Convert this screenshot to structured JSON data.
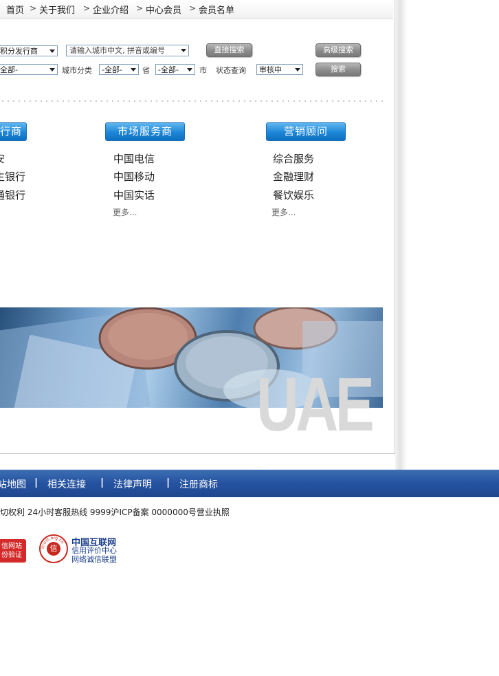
{
  "breadcrumb": {
    "items": [
      "首页",
      "关于我们",
      "企业介绍",
      "中心会员",
      "会员名单"
    ],
    "separator": ">"
  },
  "search": {
    "issuer_select": "积分发行商",
    "city_input_placeholder": "请输入城市中文, 拼音或编号",
    "direct_search_label": "直接搜索",
    "advanced_search_label": "高级搜索",
    "row2_select_value": "全部-",
    "city_category_label": "城市分类",
    "city_category_value": "-全部-",
    "province_label": "省",
    "city_select_value": "-全部-",
    "city_label": "市",
    "status_label": "状态查询",
    "status_value": "审核中",
    "search_label": "搜索"
  },
  "categories": [
    {
      "title": "行商",
      "items": [
        "安",
        "生银行",
        "通银行"
      ],
      "more": ""
    },
    {
      "title": "市场服务商",
      "items": [
        "中国电信",
        "中国移动",
        "中国实话"
      ],
      "more": "更多..."
    },
    {
      "title": "营销顾问",
      "items": [
        "综合服务",
        "金融理财",
        "餐饮娱乐"
      ],
      "more": "更多..."
    }
  ],
  "banner": {
    "overlay_text": "UAE"
  },
  "footer": {
    "links": [
      "站地图",
      "相关连接",
      "法律声明",
      "注册商标"
    ],
    "separator": "|",
    "copyright": "切权利 24小时客服热线 9999沪ICP备案 0000000号营业执照",
    "badge1_lines": [
      "信网站",
      "份验证"
    ],
    "seal_text": "信",
    "seal_ring_text": "itrust.org.cn",
    "org_title": "中国互联网",
    "org_sub1": "信用评价中心",
    "org_sub2": "网络诚信联盟"
  },
  "colors": {
    "accent_blue": "#1d86d8",
    "footer_blue": "#2552a0",
    "seal_red": "#c8281e"
  }
}
